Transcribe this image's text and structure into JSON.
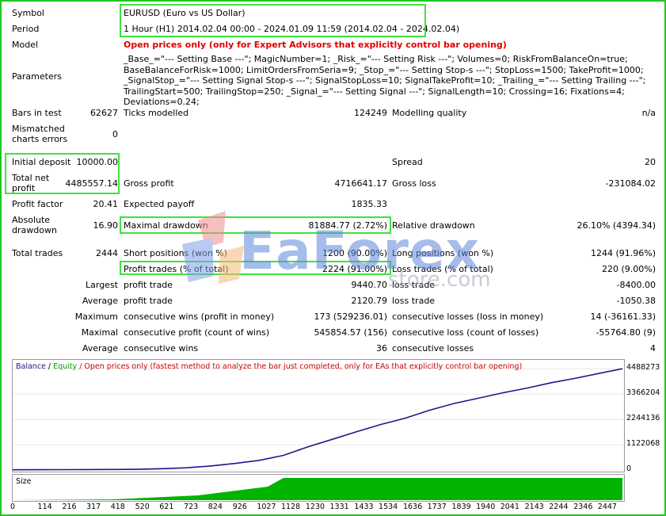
{
  "labels": {
    "symbol": "Symbol",
    "period": "Period",
    "model": "Model",
    "parameters": "Parameters",
    "bars_in_test": "Bars in test",
    "ticks_modelled": "Ticks modelled",
    "modelling_quality": "Modelling quality",
    "mismatched": "Mismatched",
    "charts_errors": "charts errors",
    "initial_deposit": "Initial deposit",
    "spread": "Spread",
    "total_net": "Total net",
    "profit": "profit",
    "gross_profit": "Gross profit",
    "gross_loss": "Gross loss",
    "profit_factor": "Profit factor",
    "expected_payoff": "Expected payoff",
    "absolute": "Absolute",
    "drawdown": "drawdown",
    "maximal_drawdown": "Maximal drawdown",
    "relative_drawdown": "Relative drawdown",
    "total_trades": "Total trades",
    "short_positions": "Short positions (won %)",
    "long_positions": "Long positions (won %)",
    "profit_trades": "Profit trades (% of total)",
    "loss_trades": "Loss trades (% of total)",
    "largest": "Largest",
    "average": "Average",
    "maximum": "Maximum",
    "maximal": "Maximal",
    "profit_trade": "profit trade",
    "loss_trade": "loss trade",
    "consec_wins_money": "consecutive wins (profit in money)",
    "consec_losses_money": "consecutive losses (loss in money)",
    "consec_profit_count": "consecutive profit (count of wins)",
    "consec_loss_count": "consecutive loss (count of losses)",
    "consec_wins": "consecutive wins",
    "consec_losses": "consecutive losses"
  },
  "values": {
    "symbol": "EURUSD (Euro vs US Dollar)",
    "period": "1 Hour (H1) 2014.02.04 00:00 - 2024.01.09 11:59 (2014.02.04 - 2024.02.04)",
    "model": "Open prices only (only for Expert Advisors that explicitly control bar opening)",
    "parameters": "_Base_=\"--- Setting Base ---\"; MagicNumber=1; _Risk_=\"--- Setting Risk ---\"; Volumes=0; RiskFromBalanceOn=true; BaseBalanceForRisk=1000; LimitOrdersFromSeria=9; _Stop_=\"--- Setting Stop-s ---\"; StopLoss=1500; TakeProfit=1000; _SignalStop_=\"--- Setting Signal Stop-s ---\"; SignalStopLoss=10; SignalTakeProfit=10; _Trailing_=\"--- Setting Trailing ---\"; TrailingStart=500; TrailingStop=250; _Signal_=\"--- Setting Signal ---\"; SignalLength=10; Crossing=16; Fixations=4; Deviations=0.24;",
    "bars_in_test": "62627",
    "ticks_modelled": "124249",
    "modelling_quality": "n/a",
    "mismatched": "0",
    "initial_deposit": "10000.00",
    "spread": "20",
    "total_net_profit": "4485557.14",
    "gross_profit": "4716641.17",
    "gross_loss": "-231084.02",
    "profit_factor": "20.41",
    "expected_payoff": "1835.33",
    "absolute_drawdown": "16.90",
    "maximal_drawdown": "81884.77 (2.72%)",
    "relative_drawdown": "26.10% (4394.34)",
    "total_trades": "2444",
    "short_positions": "1200 (90.00%)",
    "long_positions": "1244 (91.96%)",
    "profit_trades": "2224 (91.00%)",
    "loss_trades": "220 (9.00%)",
    "largest_profit": "9440.70",
    "largest_loss": "-8400.00",
    "average_profit": "2120.79",
    "average_loss": "-1050.38",
    "max_consec_wins": "173 (529236.01)",
    "max_consec_losses": "14 (-36161.33)",
    "maximal_consec_profit": "545854.57 (156)",
    "maximal_consec_loss": "-55764.80 (9)",
    "avg_consec_wins": "36",
    "avg_consec_losses": "4"
  },
  "watermark": {
    "logo_text": "EaForex",
    "sub_text": "store.com"
  },
  "colors": {
    "highlight": "#3ee23e",
    "balance": "#1a1a8c",
    "equity": "#00a000",
    "model_red": "#e00000",
    "size_fill": "#00b400"
  },
  "chart_data": {
    "type": "line",
    "legend": {
      "balance": "Balance",
      "sep": " / ",
      "equity": "Equity",
      "rest": " / Open prices only (fastest method to analyze the bar just completed, only for EAs that explicitly control bar opening)"
    },
    "y_ticks": [
      "4488273",
      "3366204",
      "2244136",
      "1122068",
      "0"
    ],
    "y_tick_values": [
      4488273,
      3366204,
      2244136,
      1122068,
      0
    ],
    "x_ticks": [
      "0",
      "114",
      "216",
      "317",
      "418",
      "520",
      "621",
      "723",
      "824",
      "926",
      "1027",
      "1128",
      "1230",
      "1331",
      "1433",
      "1534",
      "1636",
      "1737",
      "1839",
      "1940",
      "2041",
      "2143",
      "2244",
      "2346",
      "2447"
    ],
    "ylim": [
      0,
      4600000
    ],
    "xlim": [
      0,
      2540
    ],
    "series": [
      {
        "name": "Balance",
        "x": [
          0,
          114,
          216,
          317,
          418,
          520,
          621,
          723,
          824,
          926,
          1027,
          1128,
          1230,
          1331,
          1433,
          1534,
          1636,
          1737,
          1839,
          1940,
          2041,
          2143,
          2244,
          2346,
          2447,
          2540
        ],
        "y": [
          10000,
          15000,
          18000,
          22000,
          26000,
          30000,
          60000,
          100000,
          180000,
          290000,
          430000,
          650000,
          1030000,
          1360000,
          1700000,
          2020000,
          2300000,
          2650000,
          2950000,
          3180000,
          3420000,
          3630000,
          3870000,
          4070000,
          4290000,
          4488273
        ]
      }
    ],
    "size_label": "Size",
    "size_ramp": {
      "start": 418,
      "plateau": 1128
    }
  }
}
